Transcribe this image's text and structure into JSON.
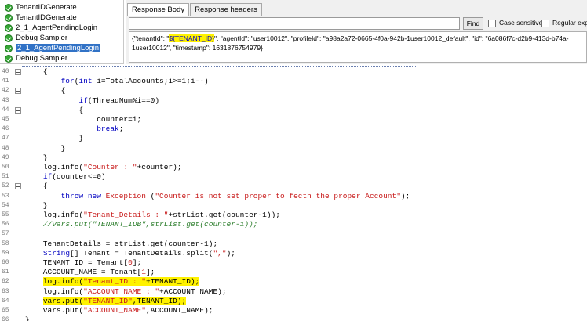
{
  "tree": {
    "items": [
      {
        "label": "TenantIDGenerate"
      },
      {
        "label": "TenantIDGenerate"
      },
      {
        "label": "2_1_AgentPendingLogin"
      },
      {
        "label": "Debug Sampler"
      },
      {
        "label": "2_1_AgentPendingLogin"
      },
      {
        "label": "Debug Sampler"
      }
    ]
  },
  "response": {
    "tabs": [
      "Response Body",
      "Response headers"
    ],
    "find_button": "Find",
    "case_sensitive": "Case sensitive",
    "regular_exp": "Regular exp.",
    "body": {
      "pre": "{\"tenantId\": \"",
      "highlight": "${TENANT_ID}",
      "post": "\", \"agentId\": \"user10012\", \"profileId\": \"a98a2a72-0665-4f0a-942b-1user10012_default\", \"id\": \"6a086f7c-d2b9-413d-b74a-1user10012\", \"timestamp\": 1631876754979}"
    }
  },
  "editor": {
    "lines": [
      {
        "n": "40",
        "fold": true,
        "segs": [
          {
            "t": "    {"
          }
        ]
      },
      {
        "n": "41",
        "fold": false,
        "segs": [
          {
            "t": "        "
          },
          {
            "t": "for",
            "c": "kw"
          },
          {
            "t": "("
          },
          {
            "t": "int",
            "c": "kw"
          },
          {
            "t": " i=TotalAccounts;i>=1;i--)"
          }
        ]
      },
      {
        "n": "42",
        "fold": true,
        "segs": [
          {
            "t": "        {"
          }
        ]
      },
      {
        "n": "43",
        "fold": false,
        "segs": [
          {
            "t": "            "
          },
          {
            "t": "if",
            "c": "kw"
          },
          {
            "t": "(ThreadNum%i==0)"
          }
        ]
      },
      {
        "n": "44",
        "fold": true,
        "segs": [
          {
            "t": "            {"
          }
        ]
      },
      {
        "n": "45",
        "fold": false,
        "segs": [
          {
            "t": "                counter=i;"
          }
        ]
      },
      {
        "n": "46",
        "fold": false,
        "segs": [
          {
            "t": "                "
          },
          {
            "t": "break",
            "c": "kw"
          },
          {
            "t": ";"
          }
        ]
      },
      {
        "n": "47",
        "fold": false,
        "segs": [
          {
            "t": "            }"
          }
        ]
      },
      {
        "n": "48",
        "fold": false,
        "segs": [
          {
            "t": "        }"
          }
        ]
      },
      {
        "n": "49",
        "fold": false,
        "segs": [
          {
            "t": "    }"
          }
        ]
      },
      {
        "n": "50",
        "fold": false,
        "segs": [
          {
            "t": "    log.info("
          },
          {
            "t": "\"Counter : \"",
            "c": "str"
          },
          {
            "t": "+counter);"
          }
        ]
      },
      {
        "n": "51",
        "fold": false,
        "segs": [
          {
            "t": "    "
          },
          {
            "t": "if",
            "c": "kw"
          },
          {
            "t": "(counter<=0)"
          }
        ]
      },
      {
        "n": "52",
        "fold": true,
        "segs": [
          {
            "t": "    {"
          }
        ]
      },
      {
        "n": "53",
        "fold": false,
        "segs": [
          {
            "t": "        "
          },
          {
            "t": "throw new",
            "c": "kw"
          },
          {
            "t": " "
          },
          {
            "t": "Exception",
            "c": "str"
          },
          {
            "t": " ("
          },
          {
            "t": "\"Counter is not set proper to fecth the proper Account\"",
            "c": "str"
          },
          {
            "t": ");"
          }
        ]
      },
      {
        "n": "54",
        "fold": false,
        "segs": [
          {
            "t": "    }"
          }
        ]
      },
      {
        "n": "55",
        "fold": false,
        "segs": [
          {
            "t": "    log.info("
          },
          {
            "t": "\"Tenant_Details : \"",
            "c": "str"
          },
          {
            "t": "+strList.get(counter-1));"
          }
        ]
      },
      {
        "n": "56",
        "fold": false,
        "segs": [
          {
            "t": "    "
          },
          {
            "t": "//vars.put(\"TENANT_IDB\",strList.get(counter-1));",
            "c": "cm"
          }
        ]
      },
      {
        "n": "57",
        "fold": false,
        "segs": [
          {
            "t": ""
          }
        ]
      },
      {
        "n": "58",
        "fold": false,
        "segs": [
          {
            "t": "    TenantDetails = strList.get(counter-1);"
          }
        ]
      },
      {
        "n": "59",
        "fold": false,
        "segs": [
          {
            "t": "    "
          },
          {
            "t": "String",
            "c": "kw"
          },
          {
            "t": "[] Tenant = TenantDetails.split("
          },
          {
            "t": "\",\"",
            "c": "str"
          },
          {
            "t": ");"
          }
        ]
      },
      {
        "n": "60",
        "fold": false,
        "segs": [
          {
            "t": "    TENANT_ID = Tenant["
          },
          {
            "t": "0",
            "c": "str"
          },
          {
            "t": "];"
          }
        ]
      },
      {
        "n": "61",
        "fold": false,
        "segs": [
          {
            "t": "    ACCOUNT_NAME = Tenant["
          },
          {
            "t": "1",
            "c": "str"
          },
          {
            "t": "];"
          }
        ]
      },
      {
        "n": "62",
        "fold": false,
        "segs": [
          {
            "t": "    "
          },
          {
            "t": "log.info(",
            "h": true
          },
          {
            "t": "\"Tenant_ID : \"",
            "c": "str",
            "h": true
          },
          {
            "t": "+TENANT_ID);",
            "h": true
          }
        ]
      },
      {
        "n": "63",
        "fold": false,
        "segs": [
          {
            "t": "    log.info("
          },
          {
            "t": "\"ACCOUNT_NAME : \"",
            "c": "str"
          },
          {
            "t": "+ACCOUNT_NAME);"
          }
        ]
      },
      {
        "n": "64",
        "fold": false,
        "segs": [
          {
            "t": "    "
          },
          {
            "t": "vars.put(",
            "h": true
          },
          {
            "t": "\"TENANT_ID\"",
            "c": "str",
            "h": true
          },
          {
            "t": ",TENANT_ID);",
            "h": true
          }
        ]
      },
      {
        "n": "65",
        "fold": false,
        "segs": [
          {
            "t": "    vars.put("
          },
          {
            "t": "\"ACCOUNT_NAME\"",
            "c": "str"
          },
          {
            "t": ",ACCOUNT_NAME);"
          }
        ]
      },
      {
        "n": "66",
        "fold": false,
        "segs": [
          {
            "t": "}"
          }
        ]
      }
    ]
  }
}
